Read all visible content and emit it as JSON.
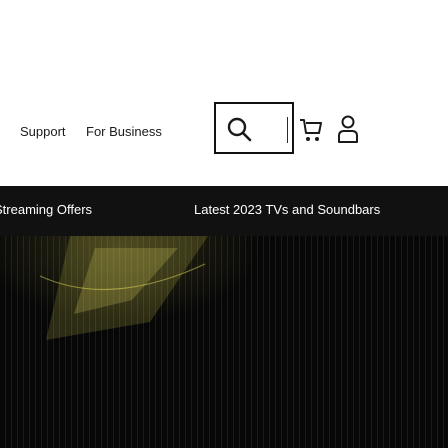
{
  "header": {
    "nav": [
      {
        "label": "Support"
      },
      {
        "label": "For Business"
      }
    ]
  },
  "icons": {
    "search": "search-icon",
    "cart": "cart-icon",
    "account": "account-icon"
  },
  "promo_bar": {
    "links": [
      {
        "label": "Streaming Offers"
      },
      {
        "label": "Latest 2023 TVs and Soundbars"
      }
    ]
  },
  "colors": {
    "header_bg": "#ffffff",
    "promo_bg": "#111111",
    "promo_text": "#ffffff",
    "hero_bg": "#050505"
  }
}
